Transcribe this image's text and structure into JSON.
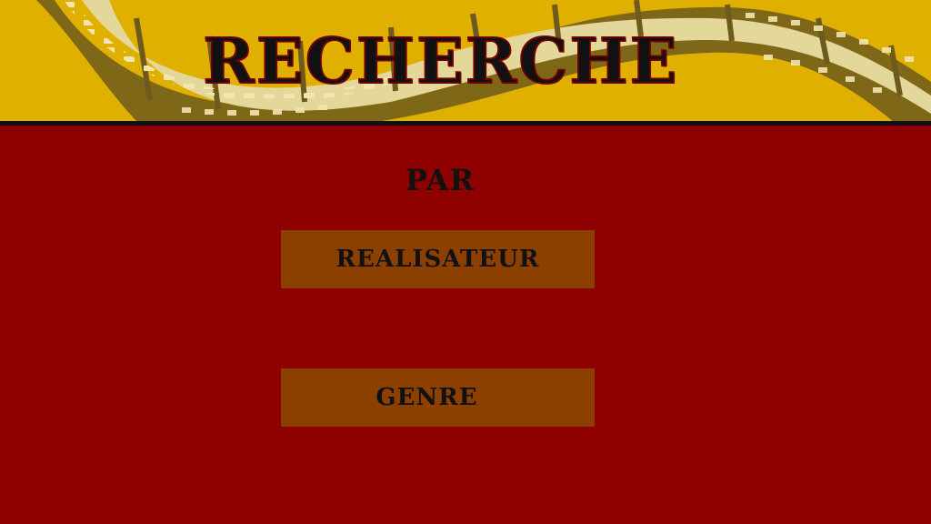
{
  "header": {
    "title": "RECHERCHE",
    "background_color": "#e0b000",
    "decoration": "film-strip-image"
  },
  "main": {
    "background_color": "#8e0000",
    "subtitle": "PAR",
    "buttons": [
      {
        "label": "REALISATEUR",
        "color": "#8b4000"
      },
      {
        "label": "GENRE",
        "color": "#8b4000"
      }
    ]
  }
}
